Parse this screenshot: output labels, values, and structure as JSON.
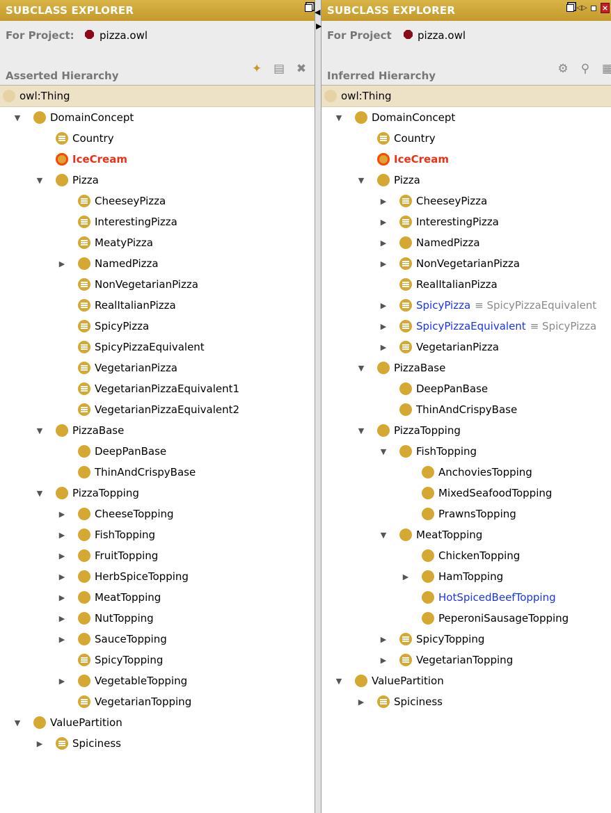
{
  "left": {
    "title": "SUBCLASS EXPLORER",
    "project_label": "For Project:",
    "project_file": "pizza.owl",
    "hierarchy_label": "Asserted Hierarchy",
    "tools": [
      "add-subclass-icon",
      "add-sibling-icon",
      "delete-class-icon"
    ],
    "root": "owl:Thing",
    "nodes": [
      {
        "label": "DomainConcept",
        "toggle": "expanded",
        "icon": "primitive"
      },
      {
        "label": "Country",
        "toggle": "none",
        "icon": "defined"
      },
      {
        "label": "IceCream",
        "toggle": "none",
        "icon": "inconsistent",
        "style": "red"
      },
      {
        "label": "Pizza",
        "toggle": "expanded",
        "icon": "primitive"
      },
      {
        "label": "CheeseyPizza",
        "toggle": "none",
        "icon": "defined"
      },
      {
        "label": "InterestingPizza",
        "toggle": "none",
        "icon": "defined"
      },
      {
        "label": "MeatyPizza",
        "toggle": "none",
        "icon": "defined"
      },
      {
        "label": "NamedPizza",
        "toggle": "collapsed",
        "icon": "primitive"
      },
      {
        "label": "NonVegetarianPizza",
        "toggle": "none",
        "icon": "defined"
      },
      {
        "label": "RealItalianPizza",
        "toggle": "none",
        "icon": "defined"
      },
      {
        "label": "SpicyPizza",
        "toggle": "none",
        "icon": "defined"
      },
      {
        "label": "SpicyPizzaEquivalent",
        "toggle": "none",
        "icon": "defined"
      },
      {
        "label": "VegetarianPizza",
        "toggle": "none",
        "icon": "defined"
      },
      {
        "label": "VegetarianPizzaEquivalent1",
        "toggle": "none",
        "icon": "defined"
      },
      {
        "label": "VegetarianPizzaEquivalent2",
        "toggle": "none",
        "icon": "defined"
      },
      {
        "label": "PizzaBase",
        "toggle": "expanded",
        "icon": "primitive"
      },
      {
        "label": "DeepPanBase",
        "toggle": "none",
        "icon": "primitive"
      },
      {
        "label": "ThinAndCrispyBase",
        "toggle": "none",
        "icon": "primitive"
      },
      {
        "label": "PizzaTopping",
        "toggle": "expanded",
        "icon": "primitive"
      },
      {
        "label": "CheeseTopping",
        "toggle": "collapsed",
        "icon": "primitive"
      },
      {
        "label": "FishTopping",
        "toggle": "collapsed",
        "icon": "primitive"
      },
      {
        "label": "FruitTopping",
        "toggle": "collapsed",
        "icon": "primitive"
      },
      {
        "label": "HerbSpiceTopping",
        "toggle": "collapsed",
        "icon": "primitive"
      },
      {
        "label": "MeatTopping",
        "toggle": "collapsed",
        "icon": "primitive"
      },
      {
        "label": "NutTopping",
        "toggle": "collapsed",
        "icon": "primitive"
      },
      {
        "label": "SauceTopping",
        "toggle": "collapsed",
        "icon": "primitive"
      },
      {
        "label": "SpicyTopping",
        "toggle": "none",
        "icon": "defined"
      },
      {
        "label": "VegetableTopping",
        "toggle": "collapsed",
        "icon": "primitive"
      },
      {
        "label": "VegetarianTopping",
        "toggle": "none",
        "icon": "defined"
      },
      {
        "label": "ValuePartition",
        "toggle": "expanded",
        "icon": "primitive"
      },
      {
        "label": "Spiciness",
        "toggle": "collapsed",
        "icon": "defined"
      }
    ]
  },
  "right": {
    "title": "SUBCLASS EXPLORER",
    "project_label": "For Project",
    "project_file": "pizza.owl",
    "hierarchy_label": "Inferred Hierarchy",
    "tools": [
      "classify-icon",
      "find-class-icon",
      "toolbar-icon"
    ],
    "root": "owl:Thing",
    "nodes": [
      {
        "label": "DomainConcept",
        "toggle": "expanded",
        "icon": "primitive"
      },
      {
        "label": "Country",
        "toggle": "none",
        "icon": "defined"
      },
      {
        "label": "IceCream",
        "toggle": "none",
        "icon": "inconsistent",
        "style": "red"
      },
      {
        "label": "Pizza",
        "toggle": "expanded",
        "icon": "primitive"
      },
      {
        "label": "CheeseyPizza",
        "toggle": "collapsed",
        "icon": "defined"
      },
      {
        "label": "InterestingPizza",
        "toggle": "collapsed",
        "icon": "defined"
      },
      {
        "label": "NamedPizza",
        "toggle": "collapsed",
        "icon": "primitive"
      },
      {
        "label": "NonVegetarianPizza",
        "toggle": "collapsed",
        "icon": "defined"
      },
      {
        "label": "RealItalianPizza",
        "toggle": "none",
        "icon": "defined"
      },
      {
        "label": "SpicyPizza",
        "toggle": "collapsed",
        "icon": "defined",
        "style": "blue",
        "equiv": "≡ SpicyPizzaEquivalent"
      },
      {
        "label": "SpicyPizzaEquivalent",
        "toggle": "collapsed",
        "icon": "defined",
        "style": "blue",
        "equiv": "≡ SpicyPizza"
      },
      {
        "label": "VegetarianPizza",
        "toggle": "collapsed",
        "icon": "defined"
      },
      {
        "label": "PizzaBase",
        "toggle": "expanded",
        "icon": "primitive"
      },
      {
        "label": "DeepPanBase",
        "toggle": "none",
        "icon": "primitive"
      },
      {
        "label": "ThinAndCrispyBase",
        "toggle": "none",
        "icon": "primitive"
      },
      {
        "label": "PizzaTopping",
        "toggle": "expanded",
        "icon": "primitive"
      },
      {
        "label": "FishTopping",
        "toggle": "expanded",
        "icon": "primitive"
      },
      {
        "label": "AnchoviesTopping",
        "toggle": "none",
        "icon": "primitive"
      },
      {
        "label": "MixedSeafoodTopping",
        "toggle": "none",
        "icon": "primitive"
      },
      {
        "label": "PrawnsTopping",
        "toggle": "none",
        "icon": "primitive"
      },
      {
        "label": "MeatTopping",
        "toggle": "expanded",
        "icon": "primitive"
      },
      {
        "label": "ChickenTopping",
        "toggle": "none",
        "icon": "primitive"
      },
      {
        "label": "HamTopping",
        "toggle": "collapsed",
        "icon": "primitive"
      },
      {
        "label": "HotSpicedBeefTopping",
        "toggle": "none",
        "icon": "primitive",
        "style": "blue"
      },
      {
        "label": "PeperoniSausageTopping",
        "toggle": "none",
        "icon": "primitive"
      },
      {
        "label": "SpicyTopping",
        "toggle": "collapsed",
        "icon": "defined"
      },
      {
        "label": "VegetarianTopping",
        "toggle": "collapsed",
        "icon": "defined"
      },
      {
        "label": "ValuePartition",
        "toggle": "expanded",
        "icon": "primitive"
      },
      {
        "label": "Spiciness",
        "toggle": "collapsed",
        "icon": "defined"
      }
    ]
  },
  "colors": {
    "titlebar": "#c9a031",
    "class_icon": "#d4a832",
    "inconsistent": "#e83218",
    "inferred_change": "#1a34e8"
  }
}
